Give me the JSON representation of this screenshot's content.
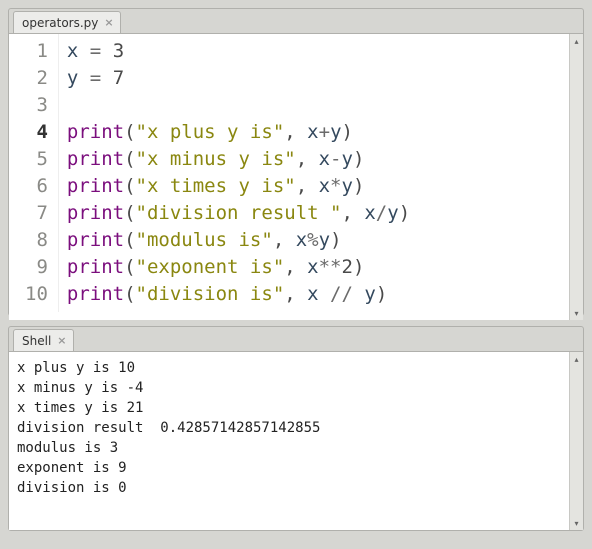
{
  "editor": {
    "tab_label": "operators.py",
    "lines": [
      {
        "n": "1",
        "html": "x <span class='tok-op'>=</span> <span class='tok-num'>3</span>"
      },
      {
        "n": "2",
        "html": "y <span class='tok-op'>=</span> <span class='tok-num'>7</span>"
      },
      {
        "n": "3",
        "html": ""
      },
      {
        "n": "4",
        "html": "<span class='tok-func'>print</span><span class='tok-paren'>(</span><span class='tok-str'>\"x plus y is\"</span><span class='tok-comma'>,</span> x<span class='tok-op'>+</span>y<span class='tok-paren'>)</span>",
        "current": true
      },
      {
        "n": "5",
        "html": "<span class='tok-func'>print</span><span class='tok-paren'>(</span><span class='tok-str'>\"x minus y is\"</span><span class='tok-comma'>,</span> x<span class='tok-op'>-</span>y<span class='tok-paren'>)</span>"
      },
      {
        "n": "6",
        "html": "<span class='tok-func'>print</span><span class='tok-paren'>(</span><span class='tok-str'>\"x times y is\"</span><span class='tok-comma'>,</span> x<span class='tok-op'>*</span>y<span class='tok-paren'>)</span>"
      },
      {
        "n": "7",
        "html": "<span class='tok-func'>print</span><span class='tok-paren'>(</span><span class='tok-str'>\"division result \"</span><span class='tok-comma'>,</span> x<span class='tok-op'>/</span>y<span class='tok-paren'>)</span>"
      },
      {
        "n": "8",
        "html": "<span class='tok-func'>print</span><span class='tok-paren'>(</span><span class='tok-str'>\"modulus is\"</span><span class='tok-comma'>,</span> x<span class='tok-op'>%</span>y<span class='tok-paren'>)</span>"
      },
      {
        "n": "9",
        "html": "<span class='tok-func'>print</span><span class='tok-paren'>(</span><span class='tok-str'>\"exponent is\"</span><span class='tok-comma'>,</span> x<span class='tok-op'>**</span><span class='tok-num'>2</span><span class='tok-paren'>)</span>"
      },
      {
        "n": "10",
        "html": "<span class='tok-func'>print</span><span class='tok-paren'>(</span><span class='tok-str'>\"division is\"</span><span class='tok-comma'>,</span> x <span class='tok-op'>//</span> y<span class='tok-paren'>)</span>"
      }
    ]
  },
  "shell": {
    "tab_label": "Shell",
    "output": [
      "x plus y is 10",
      "x minus y is -4",
      "x times y is 21",
      "division result  0.42857142857142855",
      "modulus is 3",
      "exponent is 9",
      "division is 0"
    ]
  },
  "glyph": {
    "up": "▴",
    "down": "▾",
    "close": "×"
  }
}
